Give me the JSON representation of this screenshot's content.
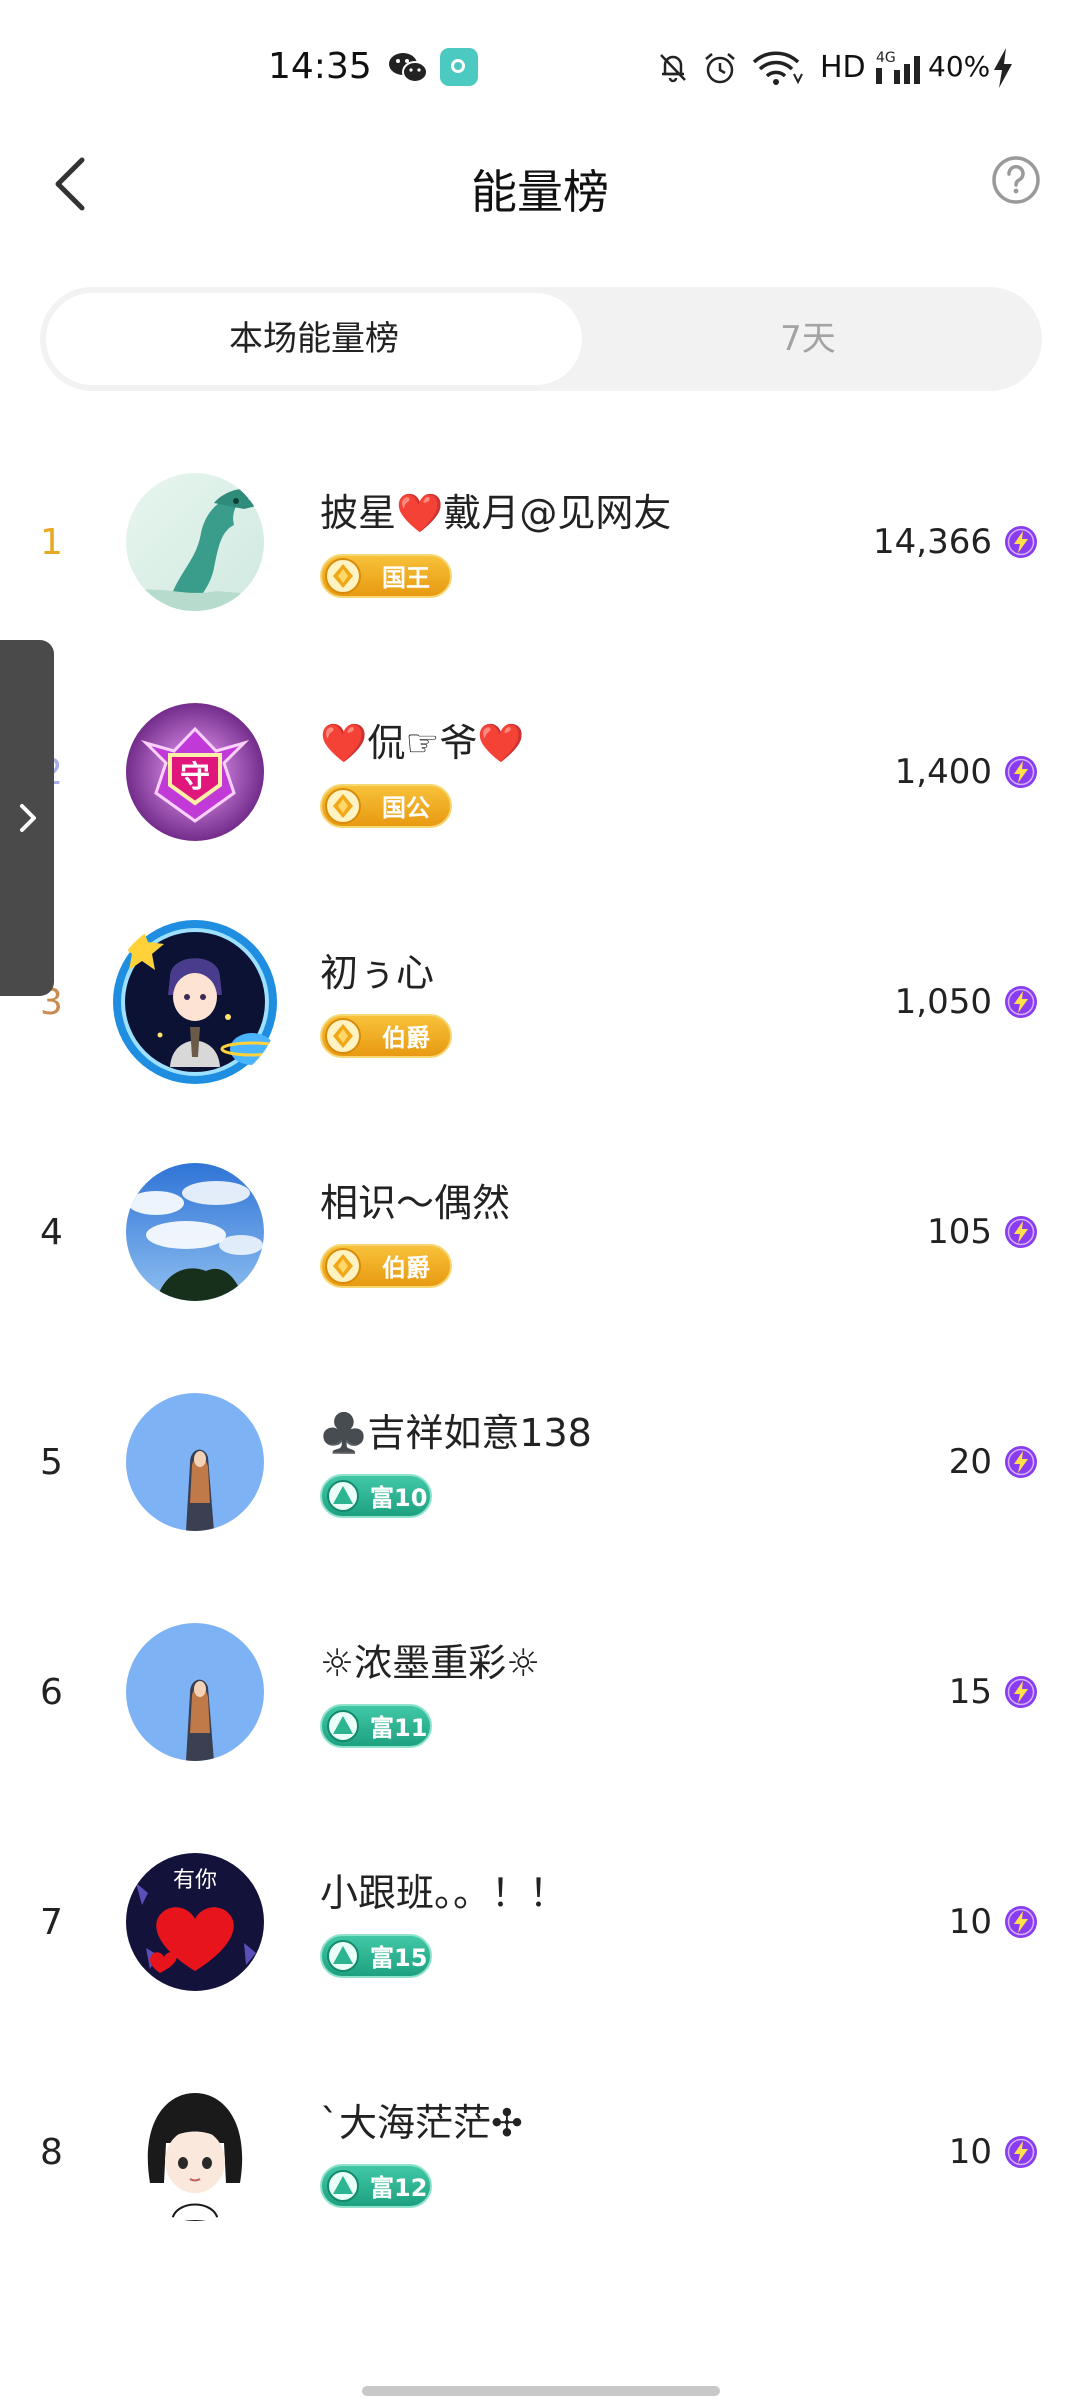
{
  "status_bar": {
    "time": "14:35",
    "network_label": "HD",
    "signal_label": "4G",
    "battery": "40%",
    "icons": [
      "wechat-icon",
      "app-notification-icon",
      "mute-bell-icon",
      "alarm-icon",
      "wifi-icon",
      "signal-icon",
      "charging-bolt-icon"
    ]
  },
  "header": {
    "title": "能量榜",
    "back_icon": "chevron-left-icon",
    "help_icon": "question-circle-icon"
  },
  "tabs": [
    {
      "label": "本场能量榜",
      "selected": true
    },
    {
      "label": "7天",
      "selected": false
    }
  ],
  "rankings": [
    {
      "rank": "1",
      "name": "披星❤️戴月@见网友",
      "badge": "国王",
      "badge_type": "noble",
      "score": "14,366"
    },
    {
      "rank": "2",
      "name": "❤️侃☞爷❤️",
      "badge": "国公",
      "badge_type": "noble",
      "score": "1,400"
    },
    {
      "rank": "3",
      "name": "初ぅ心",
      "badge": "伯爵",
      "badge_type": "noble",
      "score": "1,050"
    },
    {
      "rank": "4",
      "name": "相识～偶然",
      "badge": "伯爵",
      "badge_type": "noble",
      "score": "105"
    },
    {
      "rank": "5",
      "name": "♣️吉祥如意138",
      "badge": "富10",
      "badge_type": "rich",
      "score": "20"
    },
    {
      "rank": "6",
      "name": "☼浓墨重彩☼",
      "badge": "富11",
      "badge_type": "rich",
      "score": "15"
    },
    {
      "rank": "7",
      "name": "小跟班。。！！",
      "badge": "富15",
      "badge_type": "rich",
      "score": "10"
    },
    {
      "rank": "8",
      "name": "`大海茫茫✣",
      "badge": "富12",
      "badge_type": "rich",
      "score": "10"
    }
  ],
  "avatar_7_text": "有你",
  "colors": {
    "rank_gold": "#e8a823",
    "rank_silver": "#a9aee6",
    "rank_bronze": "#c98b4f",
    "noble_badge": "#f0ab20",
    "rich_badge": "#2db592",
    "energy_icon": "#8a3df0",
    "side_tab": "#4a4a4a"
  }
}
